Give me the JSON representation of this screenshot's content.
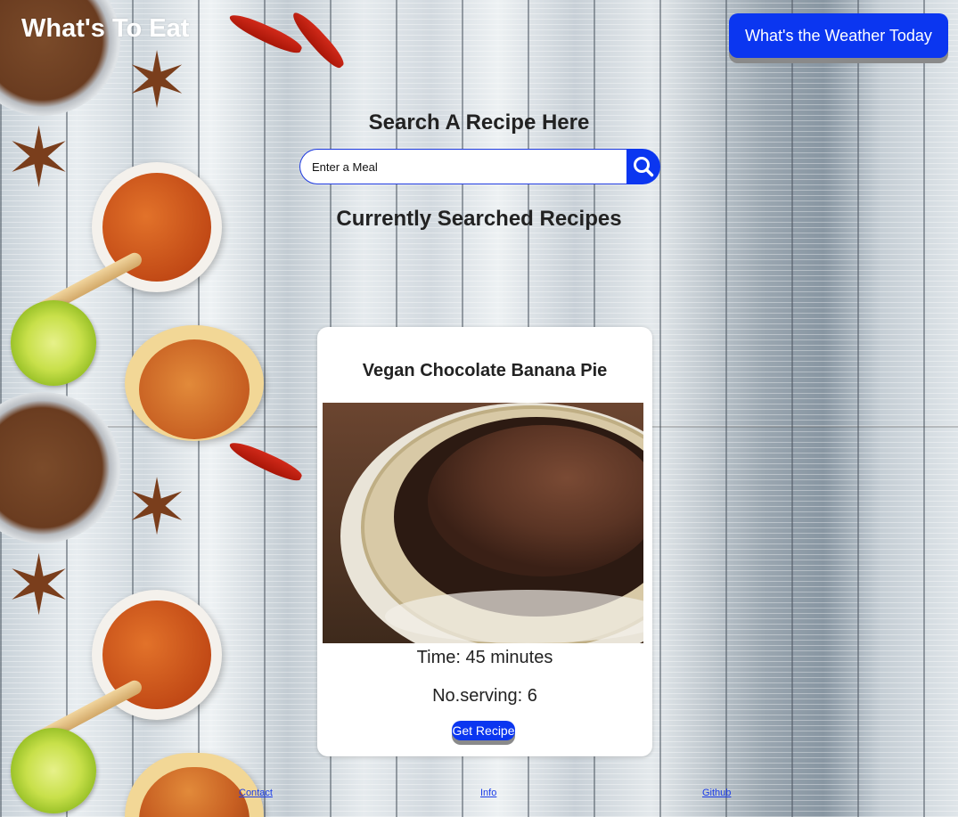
{
  "header": {
    "brand": "What's To Eat",
    "weather_button": "What's the Weather Today"
  },
  "search": {
    "title": "Search A Recipe Here",
    "placeholder": "Enter a Meal",
    "button_icon": "search-icon"
  },
  "results": {
    "title": "Currently Searched Recipes",
    "recipes": [
      {
        "name": "Vegan Chocolate Banana Pie",
        "time": "Time: 45 minutes",
        "servings": "No.serving: 6",
        "button": "Get Recipe"
      }
    ]
  },
  "footer": {
    "links": [
      "Contact",
      "Info",
      "Github"
    ]
  },
  "colors": {
    "accent": "#0b36f0",
    "text": "#222222",
    "card_bg": "#ffffff",
    "link": "#1a3ce8"
  }
}
